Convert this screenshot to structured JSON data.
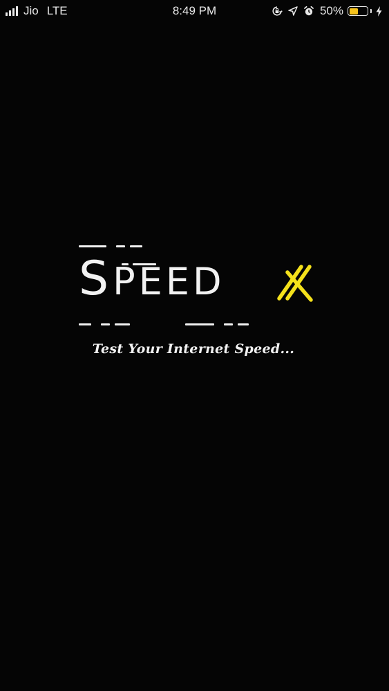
{
  "status_bar": {
    "carrier": "Jio",
    "network": "LTE",
    "time": "8:49 PM",
    "battery_percent_label": "50%",
    "battery_level": 0.5,
    "icons": [
      "signal-icon",
      "orientation-lock-icon",
      "location-arrow-icon",
      "alarm-icon",
      "battery-icon",
      "charging-bolt-icon"
    ]
  },
  "logo": {
    "first_letter": "S",
    "rest": "PEED",
    "mark_letter": "X",
    "accent_color": "#f4e11b"
  },
  "tagline": "Test Your Internet Speed..."
}
